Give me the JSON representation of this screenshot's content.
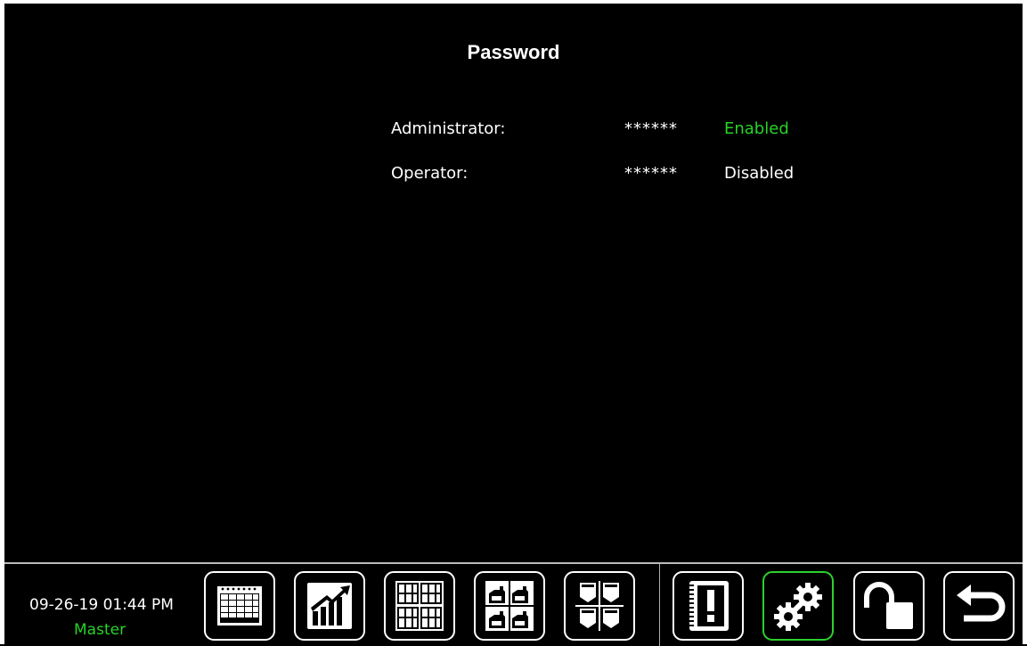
{
  "header": {
    "title": "Password"
  },
  "accounts": [
    {
      "label": "Administrator:",
      "password_mask": "******",
      "status": "Enabled"
    },
    {
      "label": "Operator:",
      "password_mask": "******",
      "status": "Disabled"
    }
  ],
  "footer": {
    "datetime": "09-26-19 01:44 PM",
    "user": "Master",
    "buttons": [
      {
        "icon": "calendar-icon"
      },
      {
        "icon": "trend-chart-icon"
      },
      {
        "icon": "sensor-grid-icon"
      },
      {
        "icon": "bottle-grid-icon"
      },
      {
        "icon": "tank-grid-icon"
      },
      {
        "icon": "alarm-notebook-icon"
      },
      {
        "icon": "settings-gears-icon",
        "active": true
      },
      {
        "icon": "unlock-icon"
      },
      {
        "icon": "back-arrow-icon"
      }
    ]
  },
  "colors": {
    "enabled": "#27d327",
    "active_border": "#2bd12b",
    "background": "#000000",
    "text": "#ffffff"
  }
}
